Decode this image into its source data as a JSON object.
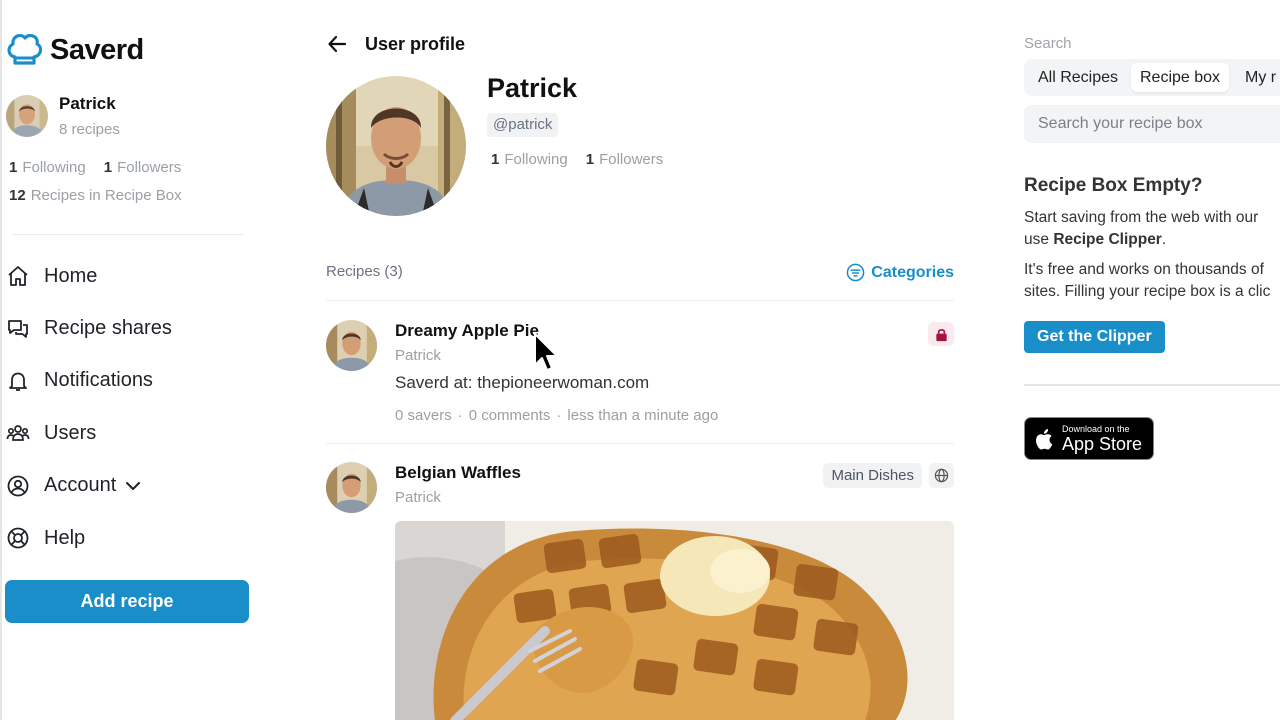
{
  "brand": {
    "name": "Saverd",
    "accent": "#1a8ec9"
  },
  "current_user": {
    "name": "Patrick",
    "recipes_text": "8 recipes",
    "following_count": "1",
    "following_label": "Following",
    "followers_count": "1",
    "followers_label": "Followers",
    "recipebox_count": "12",
    "recipebox_label": "Recipes in Recipe Box"
  },
  "nav": [
    {
      "label": "Home",
      "icon": "home-icon"
    },
    {
      "label": "Recipe shares",
      "icon": "chat-bubbles-icon"
    },
    {
      "label": "Notifications",
      "icon": "bell-icon"
    },
    {
      "label": "Users",
      "icon": "users-icon"
    },
    {
      "label": "Account",
      "icon": "user-circle-icon"
    },
    {
      "label": "Help",
      "icon": "lifebuoy-icon"
    }
  ],
  "add_recipe_label": "Add recipe",
  "page": {
    "title": "User profile",
    "profile": {
      "name": "Patrick",
      "handle": "@patrick",
      "following_count": "1",
      "following_label": "Following",
      "followers_count": "1",
      "followers_label": "Followers"
    },
    "recipes_header": "Recipes (3)",
    "categories_label": "Categories",
    "recipes": [
      {
        "title": "Dreamy Apple Pie",
        "author": "Patrick",
        "source": "Saverd at: thepioneerwoman.com",
        "savers": "0 savers",
        "comments": "0 comments",
        "time": "less than a minute ago",
        "visibility": "private",
        "badge_color": "#a3123f"
      },
      {
        "title": "Belgian Waffles",
        "author": "Patrick",
        "category": "Main Dishes",
        "visibility": "public"
      }
    ]
  },
  "right_panel": {
    "search_label": "Search",
    "tabs": [
      "All Recipes",
      "Recipe box",
      "My r"
    ],
    "active_tab": "Recipe box",
    "search_placeholder": "Search your recipe box",
    "empty_title": "Recipe Box Empty?",
    "empty_line1": "Start saving from the web with our",
    "empty_line2_prefix": "use",
    "empty_line2_bold": "Recipe Clipper",
    "empty_line2_suffix": ".",
    "empty_line3": "It's free and works on thousands of",
    "empty_line4": "sites. Filling your recipe box is a clic",
    "clipper_button": "Get the Clipper",
    "appstore_small": "Download on the",
    "appstore_big": "App Store"
  },
  "separator": "·"
}
